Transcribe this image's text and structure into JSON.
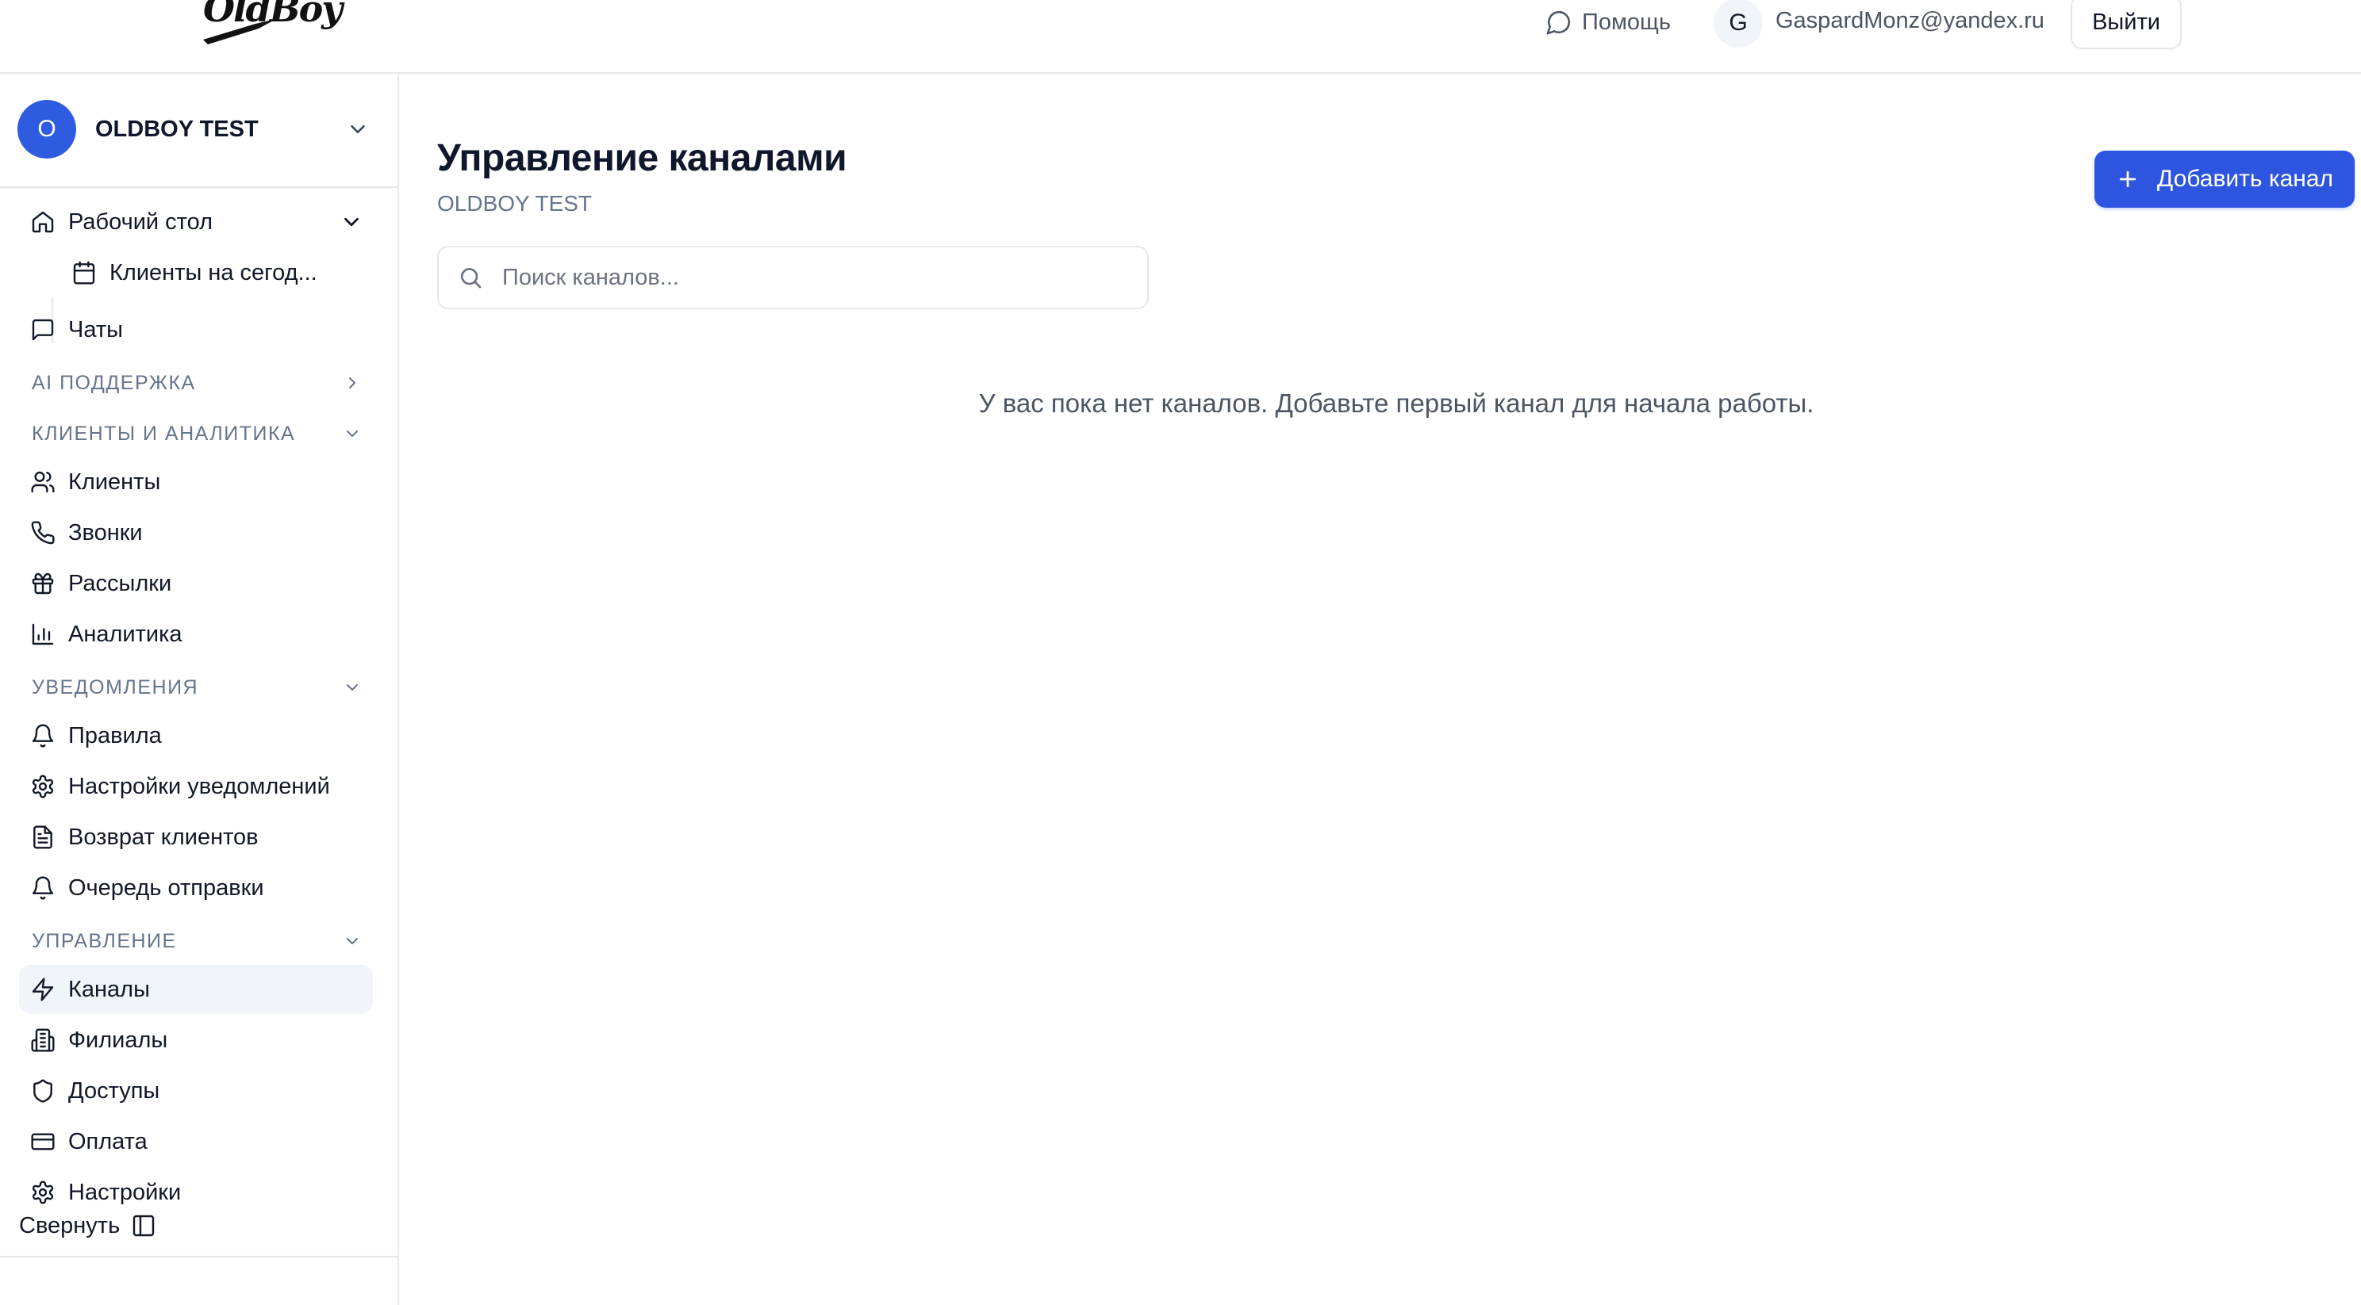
{
  "header": {
    "logo_text": "OldBoy",
    "help_label": "Помощь",
    "user_initial": "G",
    "user_email": "GaspardMonz@yandex.ru",
    "logout_label": "Выйти"
  },
  "sidebar": {
    "org": {
      "initial": "O",
      "name": "OLDBOY TEST"
    },
    "items": {
      "desktop": "Рабочий стол",
      "clients_today": "Клиенты на сегод...",
      "chats": "Чаты"
    },
    "sections": {
      "ai_support": {
        "label": "AI ПОДДЕРЖКА"
      },
      "clients_analytics": {
        "label": "КЛИЕНТЫ И АНАЛИТИКА",
        "items": [
          "Клиенты",
          "Звонки",
          "Рассылки",
          "Аналитика"
        ]
      },
      "notifications": {
        "label": "УВЕДОМЛЕНИЯ",
        "items": [
          "Правила",
          "Настройки уведомлений",
          "Возврат клиентов",
          "Очередь отправки"
        ]
      },
      "management": {
        "label": "УПРАВЛЕНИЕ",
        "items": [
          "Каналы",
          "Филиалы",
          "Доступы",
          "Оплата",
          "Настройки"
        ]
      }
    },
    "collapse_label": "Свернуть"
  },
  "main": {
    "title": "Управление каналами",
    "subtitle": "OLDBOY TEST",
    "add_button_label": "Добавить канал",
    "search_placeholder": "Поиск каналов...",
    "search_value": "",
    "empty_message": "У вас пока нет каналов. Добавьте первый канал для начала работы."
  },
  "colors": {
    "accent": "#2d55e0",
    "active_item_bg": "#f1f5f9",
    "muted_text": "#64748b",
    "border": "#e5e7eb"
  }
}
